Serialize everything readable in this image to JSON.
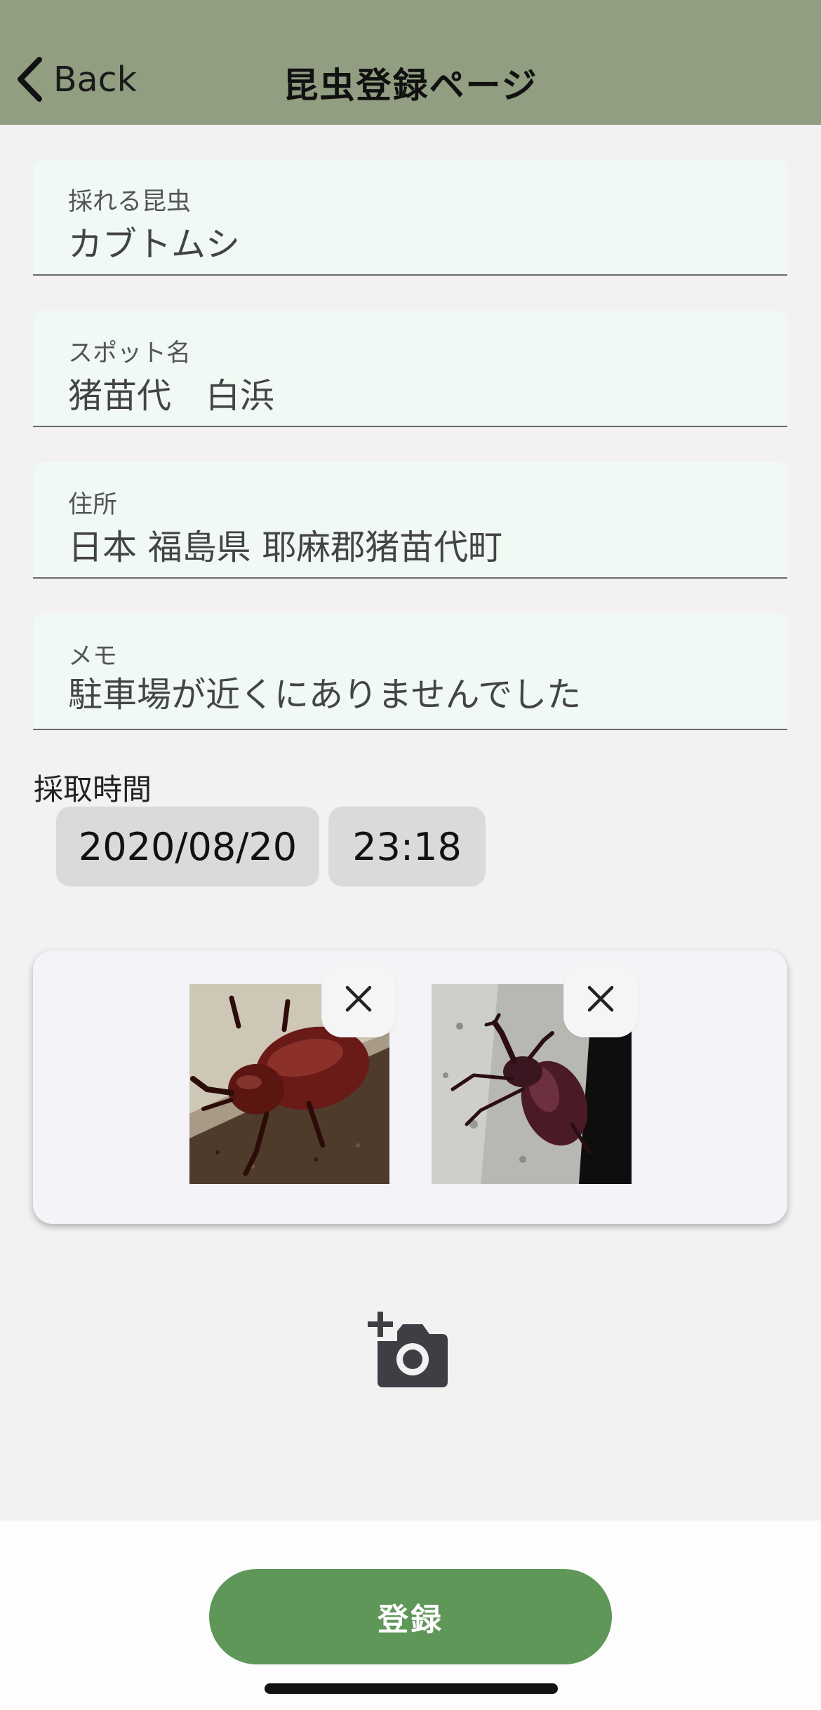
{
  "nav": {
    "back_label": "Back",
    "title": "昆虫登録ページ"
  },
  "fields": [
    {
      "label": "採れる昆虫",
      "value": "カブトムシ"
    },
    {
      "label": "スポット名",
      "value": "猪苗代　白浜"
    },
    {
      "label": "住所",
      "value": "日本 福島県 耶麻郡猪苗代町"
    },
    {
      "label": "メモ",
      "value": "駐車場が近くにありませんでした"
    }
  ],
  "capture_time": {
    "label": "採取時間",
    "date": "2020/08/20",
    "time": "23:18"
  },
  "photos": [
    "beetle-photo-1",
    "beetle-photo-2"
  ],
  "submit_label": "登録",
  "colors": {
    "nav_bg": "#919e81",
    "field_bg": "#f0f9f3",
    "submit_bg": "#5f9759",
    "pill_bg": "#dadada"
  }
}
